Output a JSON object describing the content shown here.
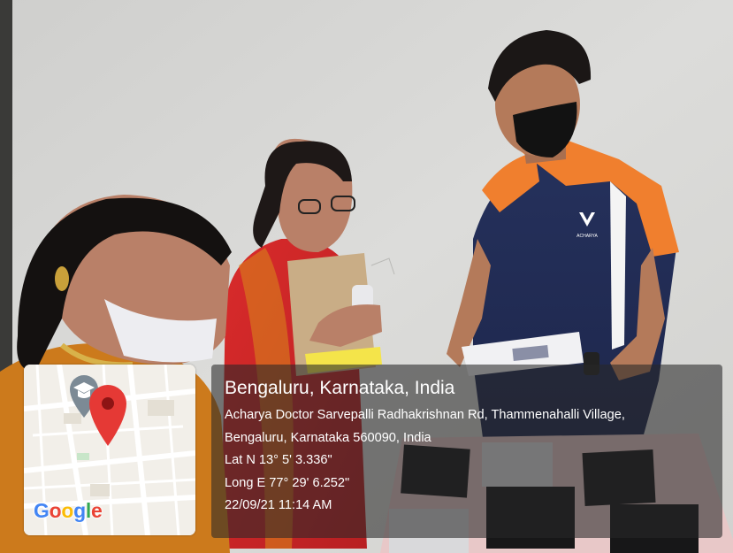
{
  "geotag": {
    "title": "Bengaluru, Karnataka, India",
    "address_line1": "Acharya Doctor Sarvepalli Radhakrishnan Rd, Thammenahalli Village,",
    "address_line2": "Bengaluru, Karnataka 560090, India",
    "latitude": "Lat N 13° 5' 3.336\"",
    "longitude": "Long E 77° 29' 6.252\"",
    "datetime": "22/09/21 11:14 AM"
  },
  "map": {
    "pin_color": "#e53935",
    "pin_icon": "map-pin-icon",
    "person_icon": "graduation-cap-icon"
  },
  "logo": {
    "letters": [
      "G",
      "o",
      "o",
      "g",
      "l",
      "e"
    ],
    "colors": [
      "#4285f4",
      "#ea4335",
      "#fbbc05",
      "#4285f4",
      "#34a853",
      "#ea4335"
    ]
  },
  "photo_text": {
    "shirt_brand": "ACHARYA"
  }
}
